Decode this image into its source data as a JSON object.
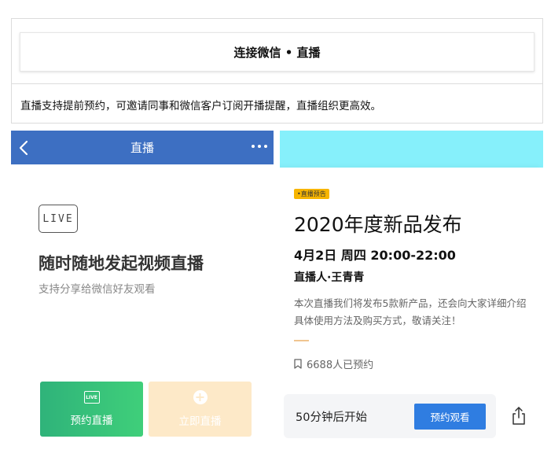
{
  "header": {
    "title": "连接微信 • 直播",
    "description": "直播支持提前预约，可邀请同事和微信客户订阅开播提醒，直播组织更高效。"
  },
  "left_screen": {
    "nav": {
      "title": "直播",
      "back_icon": "chevron-left-icon",
      "more_icon": "more-horizontal-icon"
    },
    "badge_text": "LIVE",
    "heading": "随时随地发起视频直播",
    "subtitle": "支持分享给微信好友观看",
    "buttons": {
      "reserve": {
        "label": "预约直播",
        "icon": "live-tv-icon",
        "icon_text": "LIVE"
      },
      "start_now": {
        "label": "立即直播",
        "icon": "plus-circle-icon"
      }
    }
  },
  "right_screen": {
    "tag": "•直播预告",
    "title": "2020年度新品发布",
    "time": "4月2日 周四 20:00-22:00",
    "host": "直播人·王青青",
    "description": "本次直播我们将发布5款新产品，还会向大家详细介绍具体使用方法及购买方式，敬请关注！",
    "reserve_count": "6688人已预约",
    "countdown": "50分钟后开始",
    "watch_button": "预约观看",
    "share_icon": "share-icon"
  },
  "colors": {
    "nav_blue": "#3d6fc2",
    "cyan_header": "#86f0fb",
    "green_button": "#2fb37a",
    "peach_button": "#fde9c8",
    "tag_yellow": "#f7b500",
    "watch_blue": "#2f7de1"
  }
}
